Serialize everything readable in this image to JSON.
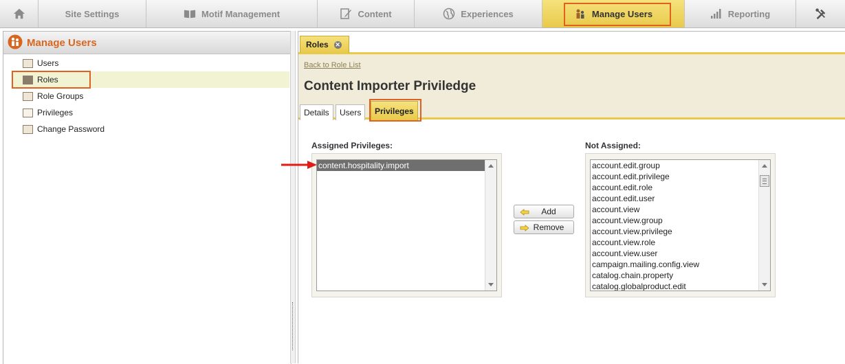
{
  "nav": {
    "items": [
      {
        "label": "",
        "icon": "home-icon"
      },
      {
        "label": "Site Settings",
        "icon": ""
      },
      {
        "label": "Motif Management",
        "icon": "book-icon"
      },
      {
        "label": "Content",
        "icon": "edit-icon"
      },
      {
        "label": "Experiences",
        "icon": "globe-icon"
      },
      {
        "label": "Manage Users",
        "icon": "users-icon"
      },
      {
        "label": "Reporting",
        "icon": "bar-chart-icon"
      },
      {
        "label": "",
        "icon": "tools-icon"
      }
    ],
    "active": "Manage Users"
  },
  "left": {
    "title": "Manage Users",
    "items": [
      "Users",
      "Roles",
      "Role Groups",
      "Privileges",
      "Change Password"
    ],
    "selected": "Roles"
  },
  "right": {
    "tab": "Roles",
    "back_link": "Back to Role List",
    "role_title": "Content Importer Priviledge",
    "subtabs": [
      "Details",
      "Users",
      "Privileges"
    ],
    "active_subtab": "Privileges",
    "assigned_label": "Assigned Privileges:",
    "not_assigned_label": "Not Assigned:",
    "assigned": [
      "content.hospitality.import"
    ],
    "not_assigned": [
      "account.edit.group",
      "account.edit.privilege",
      "account.edit.role",
      "account.edit.user",
      "account.view",
      "account.view.group",
      "account.view.privilege",
      "account.view.role",
      "account.view.user",
      "campaign.mailing.config.view",
      "catalog.chain.property",
      "catalog.globalproduct.edit"
    ],
    "add_label": "Add",
    "remove_label": "Remove"
  },
  "colors": {
    "accent_yellow": "#e8c94a",
    "highlight_orange": "#e0601f",
    "title_orange": "#d9661f",
    "annotation_red": "#e11a1a"
  }
}
